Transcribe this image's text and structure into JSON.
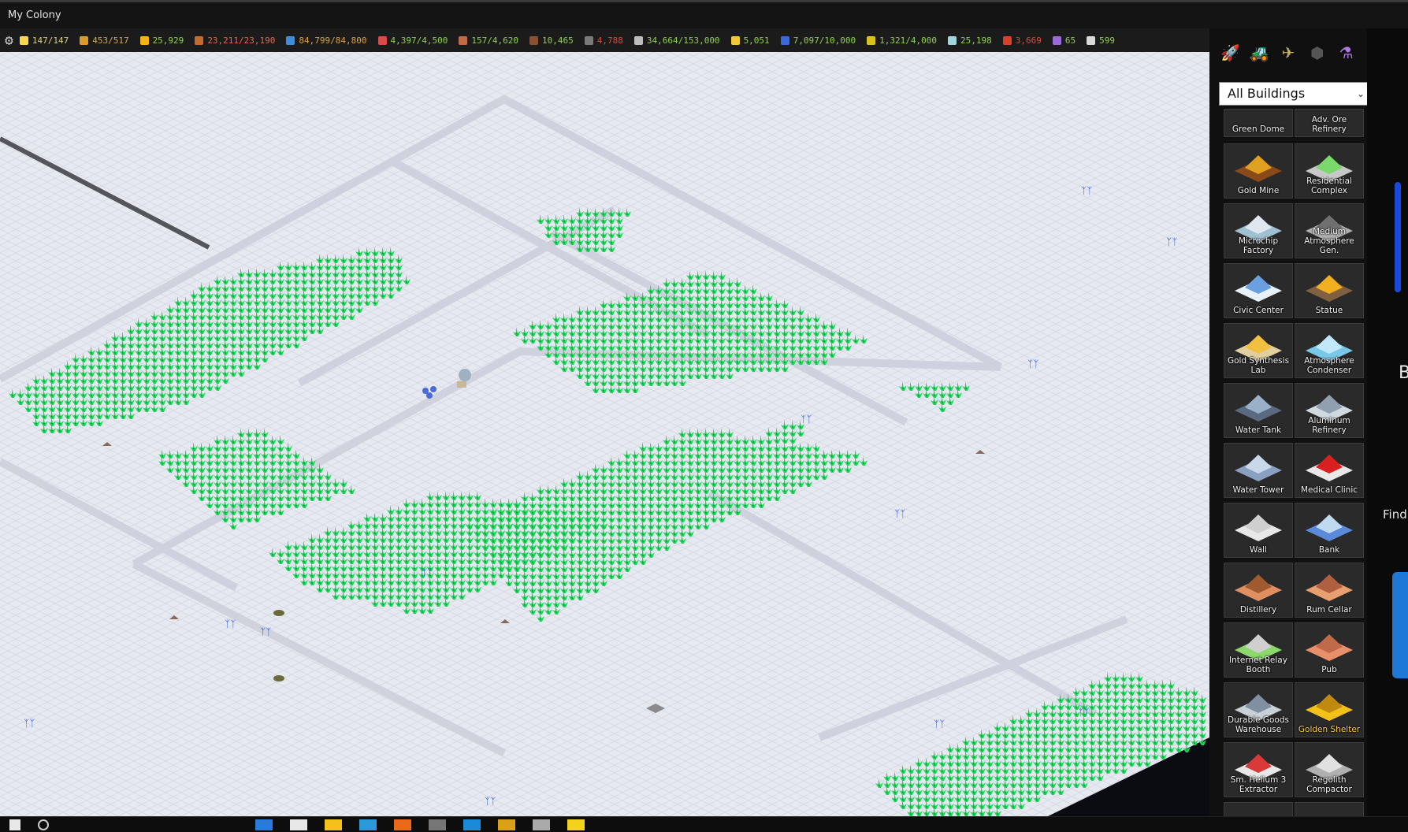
{
  "window": {
    "title": "My Colony"
  },
  "resources": [
    {
      "icon": "torch-icon",
      "value": "147/147",
      "color": "#ffd34d",
      "text_color": "#d8cf7a"
    },
    {
      "icon": "pickaxe-icon",
      "value": "453/517",
      "color": "#d99a2b",
      "text_color": "#d4a84a"
    },
    {
      "icon": "coin-icon",
      "value": "25,929",
      "color": "#f2b31a",
      "text_color": "#8ed04f"
    },
    {
      "icon": "food-icon",
      "value": "23,211/23,190",
      "color": "#c46a2b",
      "text_color": "#e06a4a"
    },
    {
      "icon": "water-drop-icon",
      "value": "84,799/84,800",
      "color": "#3c8de0",
      "text_color": "#e0a23a"
    },
    {
      "icon": "population-icon",
      "value": "4,397/4,500",
      "color": "#d94a4a",
      "text_color": "#8ed04f"
    },
    {
      "icon": "cone-icon",
      "value": "157/4,620",
      "color": "#c06a48",
      "text_color": "#8ed04f"
    },
    {
      "icon": "ore-icon",
      "value": "10,465",
      "color": "#8a5030",
      "text_color": "#8ed04f"
    },
    {
      "icon": "regolith-icon",
      "value": "4,788",
      "color": "#7a7a7a",
      "text_color": "#e04a3a"
    },
    {
      "icon": "pen-icon",
      "value": "34,664/153,000",
      "color": "#bdbdbd",
      "text_color": "#8ed04f"
    },
    {
      "icon": "sun-icon",
      "value": "5,051",
      "color": "#f2c83a",
      "text_color": "#8ed04f"
    },
    {
      "icon": "crystal-icon",
      "value": "7,097/10,000",
      "color": "#3a6ad9",
      "text_color": "#8ed04f"
    },
    {
      "icon": "chip-icon",
      "value": "1,321/4,000",
      "color": "#d9c21a",
      "text_color": "#8ed04f"
    },
    {
      "icon": "cloud-icon",
      "value": "25,198",
      "color": "#9fd6e0",
      "text_color": "#8ed04f"
    },
    {
      "icon": "rum-icon",
      "value": "3,669",
      "color": "#d9402a",
      "text_color": "#e04a3a"
    },
    {
      "icon": "gem-icon",
      "value": "65",
      "color": "#9b6ad9",
      "text_color": "#8ed04f"
    },
    {
      "icon": "bank-icon",
      "value": "599",
      "color": "#d8d8d8",
      "text_color": "#8ed04f"
    }
  ],
  "sidebar": {
    "tabs": [
      {
        "icon": "rover-icon"
      },
      {
        "icon": "bulldozer-icon"
      },
      {
        "icon": "plane-icon"
      },
      {
        "icon": "cube-icon"
      },
      {
        "icon": "flask-icon"
      }
    ],
    "filter": {
      "selected": "All Buildings"
    },
    "partial_row": [
      {
        "label": "Green Dome"
      },
      {
        "label": "Adv. Ore Refinery"
      }
    ],
    "buildings": [
      {
        "label": "Gold Mine",
        "art": "gold-mine"
      },
      {
        "label": "Residential Complex",
        "art": "residential"
      },
      {
        "label": "Microchip Factory",
        "art": "microchip"
      },
      {
        "label": "Medium Atmosphere Gen.",
        "art": "atmo-gen"
      },
      {
        "label": "Civic Center",
        "art": "civic"
      },
      {
        "label": "Statue",
        "art": "statue"
      },
      {
        "label": "Gold Synthesis Lab",
        "art": "gold-lab"
      },
      {
        "label": "Atmosphere Condenser",
        "art": "condenser"
      },
      {
        "label": "Water Tank",
        "art": "water-tank"
      },
      {
        "label": "Aluminum Refinery",
        "art": "aluminum"
      },
      {
        "label": "Water Tower",
        "art": "water-tower"
      },
      {
        "label": "Medical Clinic",
        "art": "clinic"
      },
      {
        "label": "Wall",
        "art": "wall"
      },
      {
        "label": "Bank",
        "art": "bank"
      },
      {
        "label": "Distillery",
        "art": "distillery"
      },
      {
        "label": "Rum Cellar",
        "art": "rum-cellar"
      },
      {
        "label": "Internet Relay Booth",
        "art": "relay"
      },
      {
        "label": "Pub",
        "art": "pub"
      },
      {
        "label": "Durable Goods Warehouse",
        "art": "warehouse"
      },
      {
        "label": "Golden Shelter",
        "art": "golden-shelter",
        "gold": true
      },
      {
        "label": "Sm. Helium 3 Extractor",
        "art": "helium"
      },
      {
        "label": "Regolith Compactor",
        "art": "regolith"
      }
    ]
  },
  "edge_panel": {
    "text_a": "Br",
    "text_b": "Find"
  }
}
